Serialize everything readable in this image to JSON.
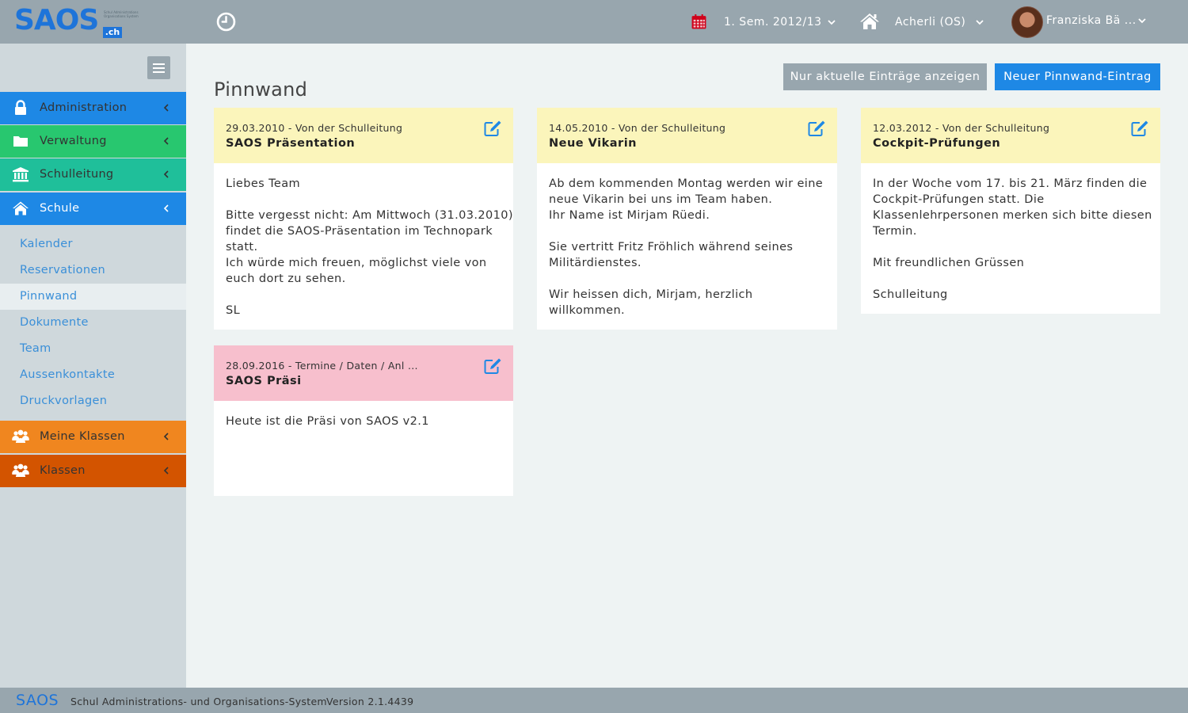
{
  "app": {
    "logo_text": "SAOS",
    "logo_tld": ".ch",
    "logo_subtitle": "Schul Administrations Organisations System"
  },
  "topbar": {
    "semester": "1. Sem. 2012/13",
    "school": "Acherli (OS)",
    "user": "Franziska Bä ...",
    "icons": [
      "clock-icon",
      "calendar-icon",
      "home-icon",
      "chevron-down-icon"
    ],
    "calendar_icon_color": "#d0021b"
  },
  "sidebar": {
    "main_items": [
      {
        "label": "Administration",
        "icon": "lock-icon",
        "color": "#1e88e5"
      },
      {
        "label": "Verwaltung",
        "icon": "folder-icon",
        "color": "#28c76f"
      },
      {
        "label": "Schulleitung",
        "icon": "institution-icon",
        "color": "#1fbf9a"
      },
      {
        "label": "Schule",
        "icon": "home-icon",
        "color": "#1e88e5"
      },
      {
        "label": "Meine Klassen",
        "icon": "users-icon",
        "color": "#f0861f"
      },
      {
        "label": "Klassen",
        "icon": "users-icon",
        "color": "#d35400"
      }
    ],
    "sub_items": [
      {
        "label": "Kalender",
        "active": false
      },
      {
        "label": "Reservationen",
        "active": false
      },
      {
        "label": "Pinnwand",
        "active": true
      },
      {
        "label": "Dokumente",
        "active": false
      },
      {
        "label": "Team",
        "active": false
      },
      {
        "label": "Aussenkontakte",
        "active": false
      },
      {
        "label": "Druckvorlagen",
        "active": false
      }
    ]
  },
  "main": {
    "title": "Pinnwand",
    "btn_current": "Nur aktuelle Einträge anzeigen",
    "btn_new": "Neuer Pinnwand-Eintrag"
  },
  "cards": [
    {
      "meta": "29.03.2010 - Von der Schulleitung",
      "title": "SAOS Präsentation",
      "color": "yellow",
      "lines": [
        "Liebes Team",
        "",
        "Bitte vergesst nicht: Am Mittwoch (31.03.2010)",
        "findet die SAOS-Präsentation im Technopark",
        "statt.",
        "Ich würde mich freuen, möglichst viele von",
        "euch dort zu sehen.",
        "",
        "SL"
      ]
    },
    {
      "meta": "14.05.2010 - Von der Schulleitung",
      "title": "Neue Vikarin",
      "color": "yellow",
      "lines": [
        "Ab dem kommenden Montag werden wir eine",
        "neue Vikarin bei uns im Team haben.",
        "Ihr Name ist Mirjam Rüedi.",
        "",
        "Sie vertritt Fritz Fröhlich während seines",
        "Militärdienstes.",
        "",
        "Wir heissen dich, Mirjam, herzlich",
        "willkommen."
      ]
    },
    {
      "meta": "12.03.2012 - Von der Schulleitung",
      "title": "Cockpit-Prüfungen",
      "color": "yellow",
      "lines": [
        "In der Woche vom 17. bis 21. März finden die",
        "Cockpit-Prüfungen statt. Die",
        "Klassenlehrpersonen merken sich bitte diesen",
        "Termin.",
        "",
        "Mit freundlichen Grüssen",
        "",
        "Schulleitung"
      ]
    },
    {
      "meta": "28.09.2016 - Termine / Daten / Anl ...",
      "title": "SAOS Präsi",
      "color": "pink",
      "lines": [
        "Heute ist die Präsi von SAOS v2.1"
      ]
    }
  ],
  "footer": {
    "logo": "SAOS",
    "description": "Schul Administrations- und Organisations-System",
    "version": "Version 2.1.4439"
  }
}
